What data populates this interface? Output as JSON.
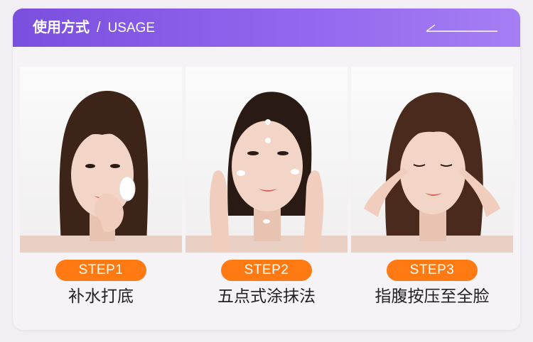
{
  "header": {
    "title_cn": "使用方式",
    "separator": "/",
    "title_en": "USAGE"
  },
  "steps": [
    {
      "badge": "STEP1",
      "caption": "补水打底"
    },
    {
      "badge": "STEP2",
      "caption": "五点式涂抹法"
    },
    {
      "badge": "STEP3",
      "caption": "指腹按压至全脸"
    }
  ],
  "colors": {
    "header_start": "#7a4fde",
    "header_end": "#a57ef3",
    "badge": "#ff7a12",
    "caption_text": "#222222",
    "card_bg": "#f5f3f5"
  }
}
